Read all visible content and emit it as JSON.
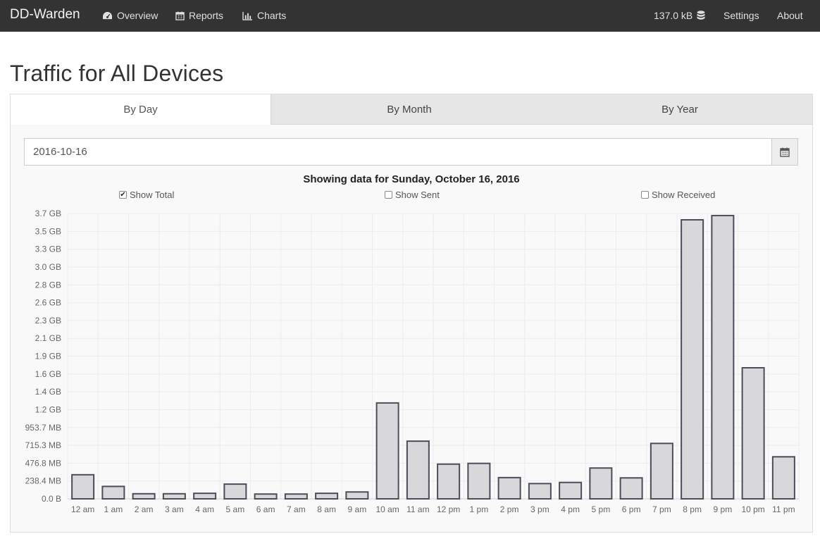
{
  "navbar": {
    "brand": "DD-Warden",
    "links": [
      {
        "label": "Overview",
        "icon": "dashboard-icon"
      },
      {
        "label": "Reports",
        "icon": "calendar-icon"
      },
      {
        "label": "Charts",
        "icon": "bar-chart-icon"
      }
    ],
    "storage": {
      "label": "137.0 kB",
      "icon": "database-icon"
    },
    "settings_label": "Settings",
    "about_label": "About"
  },
  "page_title": "Traffic for All Devices",
  "tabs": [
    {
      "label": "By Day",
      "active": true
    },
    {
      "label": "By Month",
      "active": false
    },
    {
      "label": "By Year",
      "active": false
    }
  ],
  "date_input": {
    "value": "2016-10-16",
    "icon": "calendar-icon"
  },
  "chart_heading": "Showing data for Sunday, October 16, 2016",
  "toggles": [
    {
      "label": "Show Total",
      "checked": true
    },
    {
      "label": "Show Sent",
      "checked": false
    },
    {
      "label": "Show Received",
      "checked": false
    }
  ],
  "chart_data": {
    "type": "bar",
    "title": "Showing data for Sunday, October 16, 2016",
    "xlabel": "",
    "ylabel": "",
    "categories": [
      "12 am",
      "1 am",
      "2 am",
      "3 am",
      "4 am",
      "5 am",
      "6 am",
      "7 am",
      "8 am",
      "9 am",
      "10 am",
      "11 am",
      "12 pm",
      "1 pm",
      "2 pm",
      "3 pm",
      "4 pm",
      "5 pm",
      "6 pm",
      "7 pm",
      "8 pm",
      "9 pm",
      "10 pm",
      "11 pm"
    ],
    "series": [
      {
        "name": "Show Total",
        "unit": "MB",
        "values": [
          322,
          166,
          68,
          68,
          74,
          197,
          64,
          64,
          74,
          92,
          1282,
          771,
          464,
          474,
          284,
          204,
          219,
          412,
          280,
          741,
          3730,
          3787,
          1752,
          562
        ]
      }
    ],
    "y_ticks": [
      "0.0 B",
      "238.4 MB",
      "476.8 MB",
      "715.3 MB",
      "953.7 MB",
      "1.2 GB",
      "1.4 GB",
      "1.6 GB",
      "1.9 GB",
      "2.1 GB",
      "2.3 GB",
      "2.6 GB",
      "2.8 GB",
      "3.0 GB",
      "3.3 GB",
      "3.5 GB",
      "3.7 GB"
    ],
    "ylim_mb": [
      0,
      3814.7
    ],
    "grid": true,
    "legend": "top",
    "colors": {
      "bar_fill": "#d8d8db",
      "bar_stroke": "#4a4e59",
      "grid": "#ececec"
    }
  }
}
